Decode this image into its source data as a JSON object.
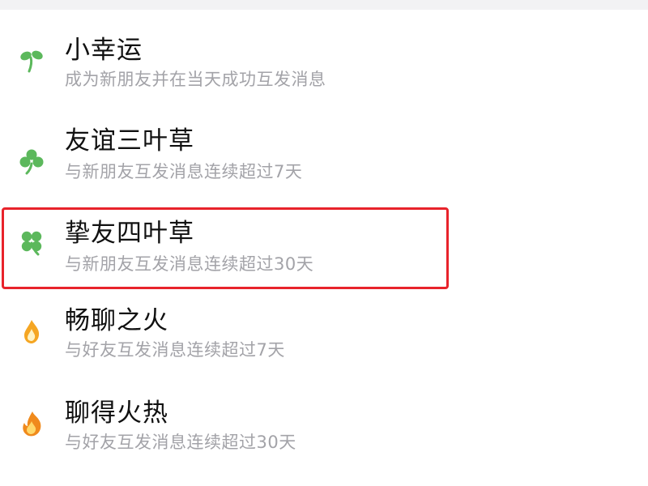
{
  "items": [
    {
      "title": "小幸运",
      "subtitle": "成为新朋友并在当天成功互发消息",
      "icon": "sprout-icon"
    },
    {
      "title": "友谊三叶草",
      "subtitle": "与新朋友互发消息连续超过7天",
      "icon": "three-leaf-clover-icon"
    },
    {
      "title": "挚友四叶草",
      "subtitle": "与新朋友互发消息连续超过30天",
      "icon": "four-leaf-clover-icon"
    },
    {
      "title": "畅聊之火",
      "subtitle": "与好友互发消息连续超过7天",
      "icon": "small-flame-icon"
    },
    {
      "title": "聊得火热",
      "subtitle": "与好友互发消息连续超过30天",
      "icon": "big-flame-icon"
    }
  ],
  "highlight": {
    "item_index": 2,
    "color": "#e8232b"
  },
  "colors": {
    "clover": "#5cb85c",
    "flame_outer": "#f5a623",
    "flame_inner": "#fff3c4",
    "title": "#111111",
    "subtitle": "#a3a3a8"
  }
}
